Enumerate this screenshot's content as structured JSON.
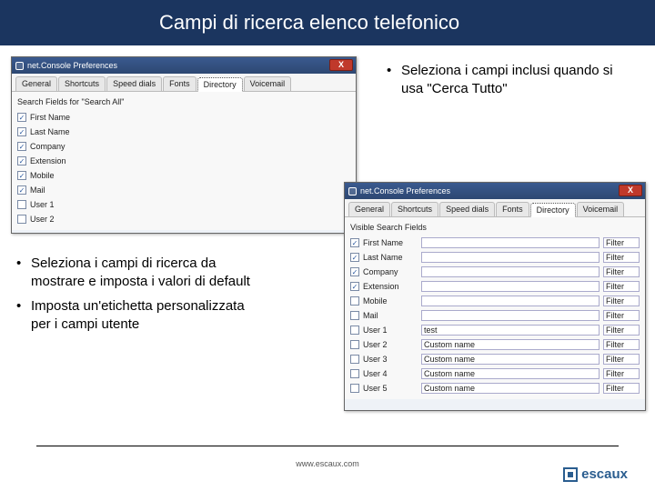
{
  "title": "Campi di ricerca elenco telefonico",
  "bullet_right": "Seleziona i campi inclusi quando si usa \"Cerca Tutto\"",
  "bullets_left": {
    "b1": "Seleziona i campi di ricerca da mostrare e imposta i valori di default",
    "b2": "Imposta un'etichetta personalizzata per i campi utente"
  },
  "prefs_window": {
    "title": "net.Console Preferences",
    "tabs": {
      "t1": "General",
      "t2": "Shortcuts",
      "t3": "Speed dials",
      "t4": "Fonts",
      "t5": "Directory",
      "t6": "Voicemail"
    },
    "close": "X"
  },
  "panel1": {
    "section": "Search Fields for \"Search All\"",
    "fields": {
      "f0": "First Name",
      "f1": "Last Name",
      "f2": "Company",
      "f3": "Extension",
      "f4": "Mobile",
      "f5": "Mail",
      "f6": "User 1",
      "f7": "User 2"
    }
  },
  "panel2": {
    "section": "Visible Search Fields",
    "rows": {
      "r0": {
        "label": "First Name",
        "val": "",
        "btn": "Filter",
        "checked": true
      },
      "r1": {
        "label": "Last Name",
        "val": "",
        "btn": "Filter",
        "checked": true
      },
      "r2": {
        "label": "Company",
        "val": "",
        "btn": "Filter",
        "checked": true
      },
      "r3": {
        "label": "Extension",
        "val": "",
        "btn": "Filter",
        "checked": true
      },
      "r4": {
        "label": "Mobile",
        "val": "",
        "btn": "Filter",
        "checked": false
      },
      "r5": {
        "label": "Mail",
        "val": "",
        "btn": "Filter",
        "checked": false
      },
      "r6": {
        "label": "User 1",
        "val": "test",
        "btn": "Filter",
        "checked": false
      },
      "r7": {
        "label": "User 2",
        "val": "Custom name",
        "btn": "Filter",
        "checked": false
      },
      "r8": {
        "label": "User 3",
        "val": "Custom name",
        "btn": "Filter",
        "checked": false
      },
      "r9": {
        "label": "User 4",
        "val": "Custom name",
        "btn": "Filter",
        "checked": false
      },
      "r10": {
        "label": "User 5",
        "val": "Custom name",
        "btn": "Filter",
        "checked": false
      }
    }
  },
  "footer": {
    "url": "www.escaux.com",
    "brand": "escaux"
  }
}
